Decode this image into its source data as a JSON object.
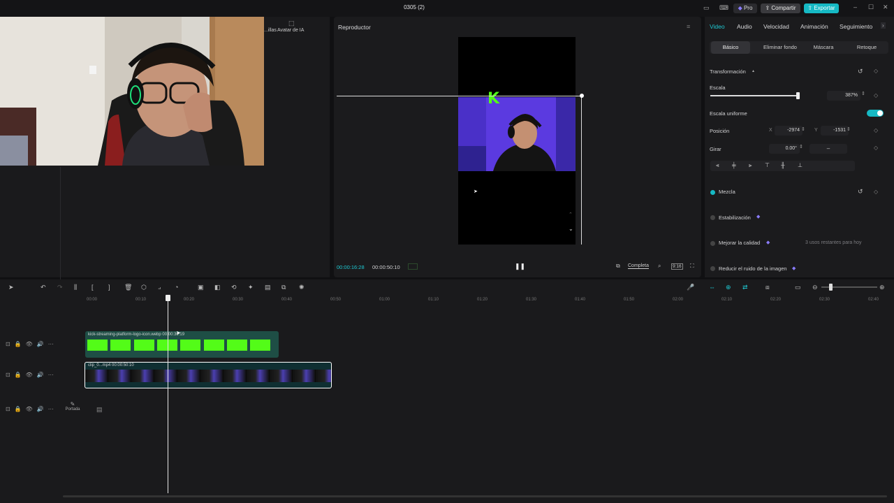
{
  "titlebar": {
    "title": "0305 (2)",
    "pro_label": "Pro",
    "share_label": "Compartir",
    "export_label": "Exportar"
  },
  "left_panel": {
    "tabs": [
      "...illas",
      "Avatar de IA"
    ]
  },
  "player": {
    "title": "Reproductor",
    "current_time": "00:00:16:28",
    "total_time": "00:00:50:10",
    "fit_label": "Completa",
    "ratio_label": "9:16"
  },
  "right_panel": {
    "tabs": [
      "Video",
      "Audio",
      "Velocidad",
      "Animación",
      "Seguimiento"
    ],
    "active_tab": "Video",
    "subtabs": [
      "Básico",
      "Eliminar fondo",
      "Máscara",
      "Retoque"
    ],
    "active_subtab": "Básico",
    "transform_label": "Transformación",
    "scale_label": "Escala",
    "scale_value": "387%",
    "scale_level": 0.75,
    "uniform_scale_label": "Escala uniforme",
    "position_label": "Posición",
    "pos_x_label": "X",
    "pos_x_value": "-2974",
    "pos_y_label": "Y",
    "pos_y_value": "-1531",
    "rotate_label": "Girar",
    "rotate_value": "0.00°",
    "rotate_minus": "–",
    "blend_label": "Mezcla",
    "stabilize_label": "Estabilización",
    "enhance_label": "Mejorar la calidad",
    "enhance_note": "3 usos restantes para hoy",
    "denoise_label": "Reducir el ruido de la imagen"
  },
  "timeline": {
    "ruler": [
      "00:00",
      "00:10",
      "00:20",
      "00:30",
      "00:40",
      "00:50",
      "01:00",
      "01:10",
      "01:20",
      "01:30",
      "01:40",
      "01:50",
      "02:00",
      "02:10",
      "02:20",
      "02:30",
      "02:40"
    ],
    "clip_top_label": "kick-streaming-platform-logo-icon.webp",
    "clip_top_duration": "00:00:39:19",
    "clip_main_label": "clip_0...mp4",
    "clip_main_duration": "00:00:50:10",
    "cover_label": "Portada"
  },
  "colors": {
    "accent": "#16b9c4",
    "kick_green": "#53fc18",
    "stream_purple": "#5b3ae0"
  }
}
